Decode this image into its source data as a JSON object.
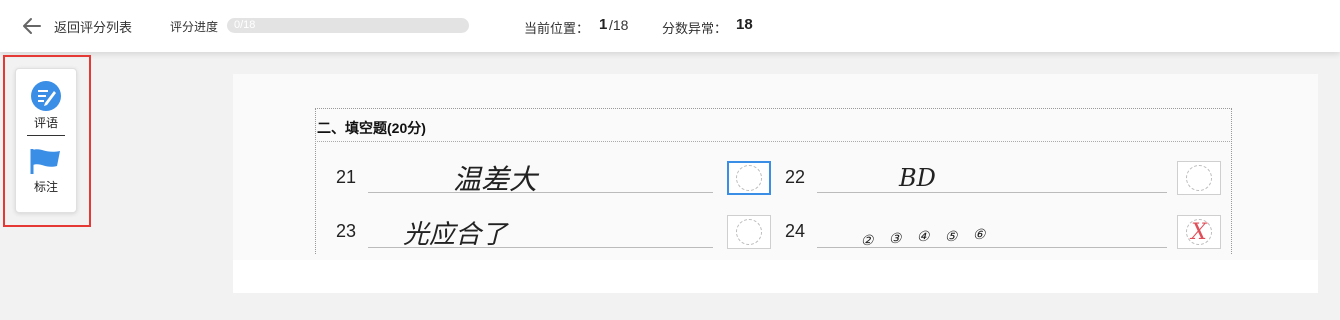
{
  "header": {
    "back_label": "返回评分列表",
    "progress_label": "评分进度",
    "progress_text": "0/18",
    "progress_value": 0,
    "position_label": "当前位置：",
    "position_current": "1",
    "position_total": "/18",
    "abnormal_label": "分数异常：",
    "abnormal_count": "18"
  },
  "tools": [
    {
      "label": "评语",
      "icon": "comment-edit-icon"
    },
    {
      "label": "标注",
      "icon": "flag-icon"
    }
  ],
  "sheet": {
    "section_title": "二、填空题(20分)",
    "questions": [
      {
        "number": "21",
        "answer": "温差大",
        "score_mark": ""
      },
      {
        "number": "22",
        "answer": "BD",
        "score_mark": ""
      },
      {
        "number": "23",
        "answer": "光应合了",
        "score_mark": ""
      },
      {
        "number": "24",
        "answer": [
          "②",
          "③",
          "④",
          "⑤",
          "⑥"
        ],
        "score_mark": "X"
      }
    ]
  },
  "colors": {
    "accent": "#3a8ee6",
    "highlight": "#e53935",
    "wrong_mark": "#e0505a"
  }
}
